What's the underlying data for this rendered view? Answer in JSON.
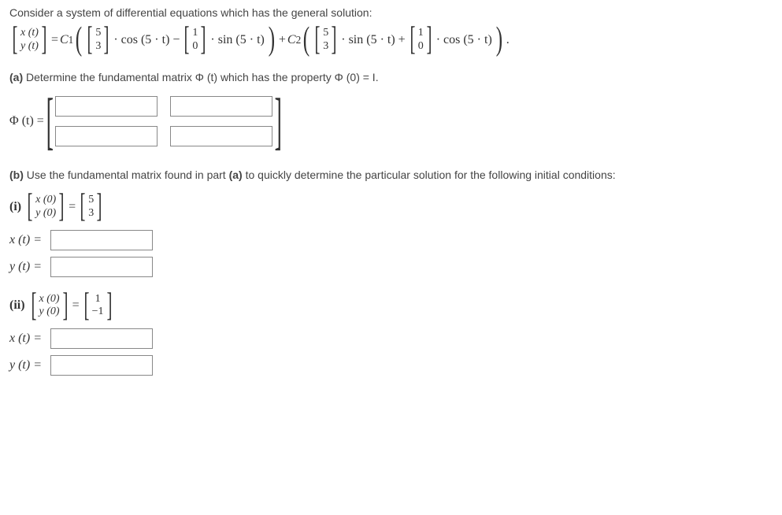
{
  "intro": "Consider a system of differential equations which has the general solution:",
  "main_eq": {
    "lhs_top": "x (t)",
    "lhs_bot": "y (t)",
    "eq": " = ",
    "c1": "C",
    "c1_sub": "1",
    "vec1_top": "5",
    "vec1_bot": "3",
    "cos1": " · cos (5 · t) − ",
    "vec2_top": "1",
    "vec2_bot": "0",
    "sin1": " · sin (5 · t)",
    "plus": "+",
    "c2": "C",
    "c2_sub": "2",
    "vec3_top": "5",
    "vec3_bot": "3",
    "sin2": " · sin (5 · t) + ",
    "vec4_top": "1",
    "vec4_bot": "0",
    "cos2": " · cos (5 · t)",
    "dot": " ."
  },
  "part_a_label": "(a)",
  "part_a_text": " Determine the fundamental matrix Φ (t) which has the property Φ (0) = I.",
  "phi_label": "Φ (t) = ",
  "part_b_label": "(b)",
  "part_b_text_1": " Use the fundamental matrix found in part ",
  "part_b_bold": "(a)",
  "part_b_text_2": " to quickly determine the particular solution for the following initial conditions:",
  "ic_i": {
    "label": "(i)",
    "lhs_top": "x (0)",
    "lhs_bot": "y (0)",
    "eq": " = ",
    "rhs_top": "5",
    "rhs_bot": "3"
  },
  "ic_ii": {
    "label": "(ii)",
    "lhs_top": "x (0)",
    "lhs_bot": "y (0)",
    "eq": " = ",
    "rhs_top": "1",
    "rhs_bot": "−1"
  },
  "xt_label": "x (t) = ",
  "yt_label": "y (t) = "
}
